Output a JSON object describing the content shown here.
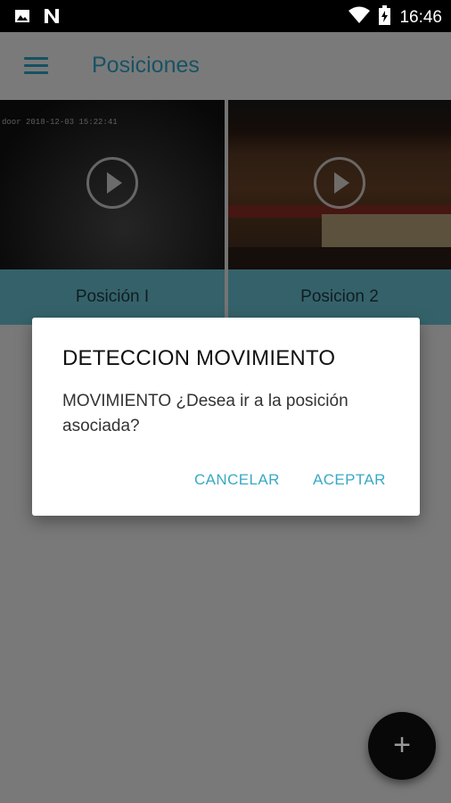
{
  "status_bar": {
    "time": "16:46"
  },
  "app_bar": {
    "title": "Posiciones"
  },
  "positions": [
    {
      "label": "Posición I",
      "timestamp": "door 2018-12-03 15:22:41"
    },
    {
      "label": "Posicion 2"
    }
  ],
  "dialog": {
    "title": "DETECCION MOVIMIENTO",
    "message": "MOVIMIENTO ¿Desea ir a la posición asociada?",
    "cancel_label": "CANCELAR",
    "accept_label": "ACEPTAR"
  },
  "fab": {
    "icon": "plus-icon",
    "label": "+"
  },
  "colors": {
    "accent": "#2ea6c6",
    "caption_bg": "#6bc4d4",
    "fab_bg": "#080808"
  }
}
